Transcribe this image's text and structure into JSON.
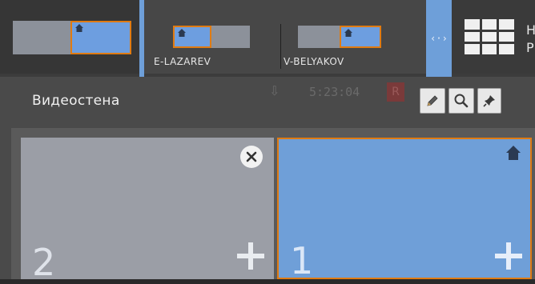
{
  "top_bar": {
    "layouts": [
      {
        "label": "E-LAZAREV"
      },
      {
        "label": "V-BELYAKOV"
      }
    ],
    "arrow_symbol": "‹·›",
    "trailing_text": [
      "H",
      "P"
    ],
    "colors": {
      "accent": "#6e9fd9",
      "highlight_border": "#e07b12"
    }
  },
  "panel": {
    "title": "Видеостена",
    "ghost_time": "5:23:04",
    "ghost_r": "R",
    "buttons": [
      "pencil-icon",
      "search-icon",
      "pin-icon"
    ],
    "tiles": [
      {
        "number": "2",
        "state": "inactive",
        "has_close": true
      },
      {
        "number": "1",
        "state": "active",
        "has_home": true
      }
    ]
  }
}
